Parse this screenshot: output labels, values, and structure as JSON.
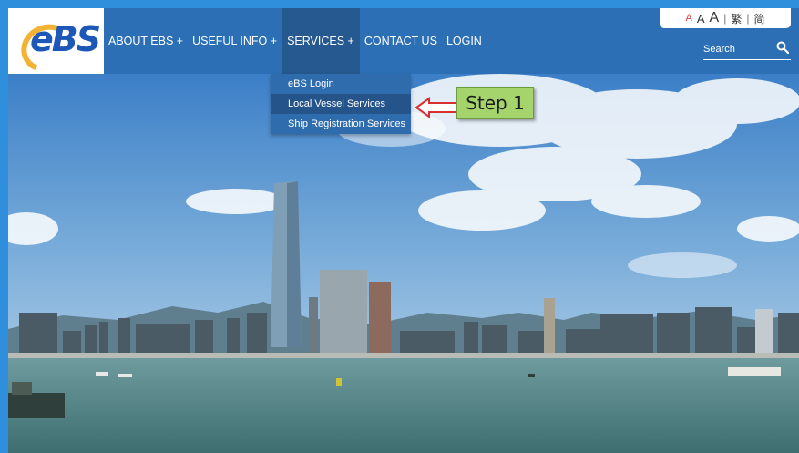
{
  "logo": {
    "text": "eBS"
  },
  "nav": {
    "items": [
      {
        "label": "ABOUT EBS +"
      },
      {
        "label": "USEFUL INFO +"
      },
      {
        "label": "SERVICES +"
      },
      {
        "label": "CONTACT US"
      },
      {
        "label": "LOGIN"
      }
    ]
  },
  "font_size": {
    "small": "A",
    "medium": "A",
    "large": "A",
    "sep": "|"
  },
  "language": {
    "traditional": "繁",
    "simplified": "简"
  },
  "search": {
    "placeholder": "Search"
  },
  "services_menu": {
    "items": [
      {
        "label": "eBS Login"
      },
      {
        "label": "Local Vessel Services"
      },
      {
        "label": "Ship Registration Services"
      }
    ]
  },
  "annotation": {
    "step_label": "Step 1"
  },
  "colors": {
    "page_border": "#2f8fdc",
    "header": "#2d6fb5",
    "menu": "#2e6cae",
    "menu_highlight": "#24548a",
    "step_box": "#a6d46c",
    "arrow": "#d9302f",
    "font_small_red": "#d83b3b"
  }
}
